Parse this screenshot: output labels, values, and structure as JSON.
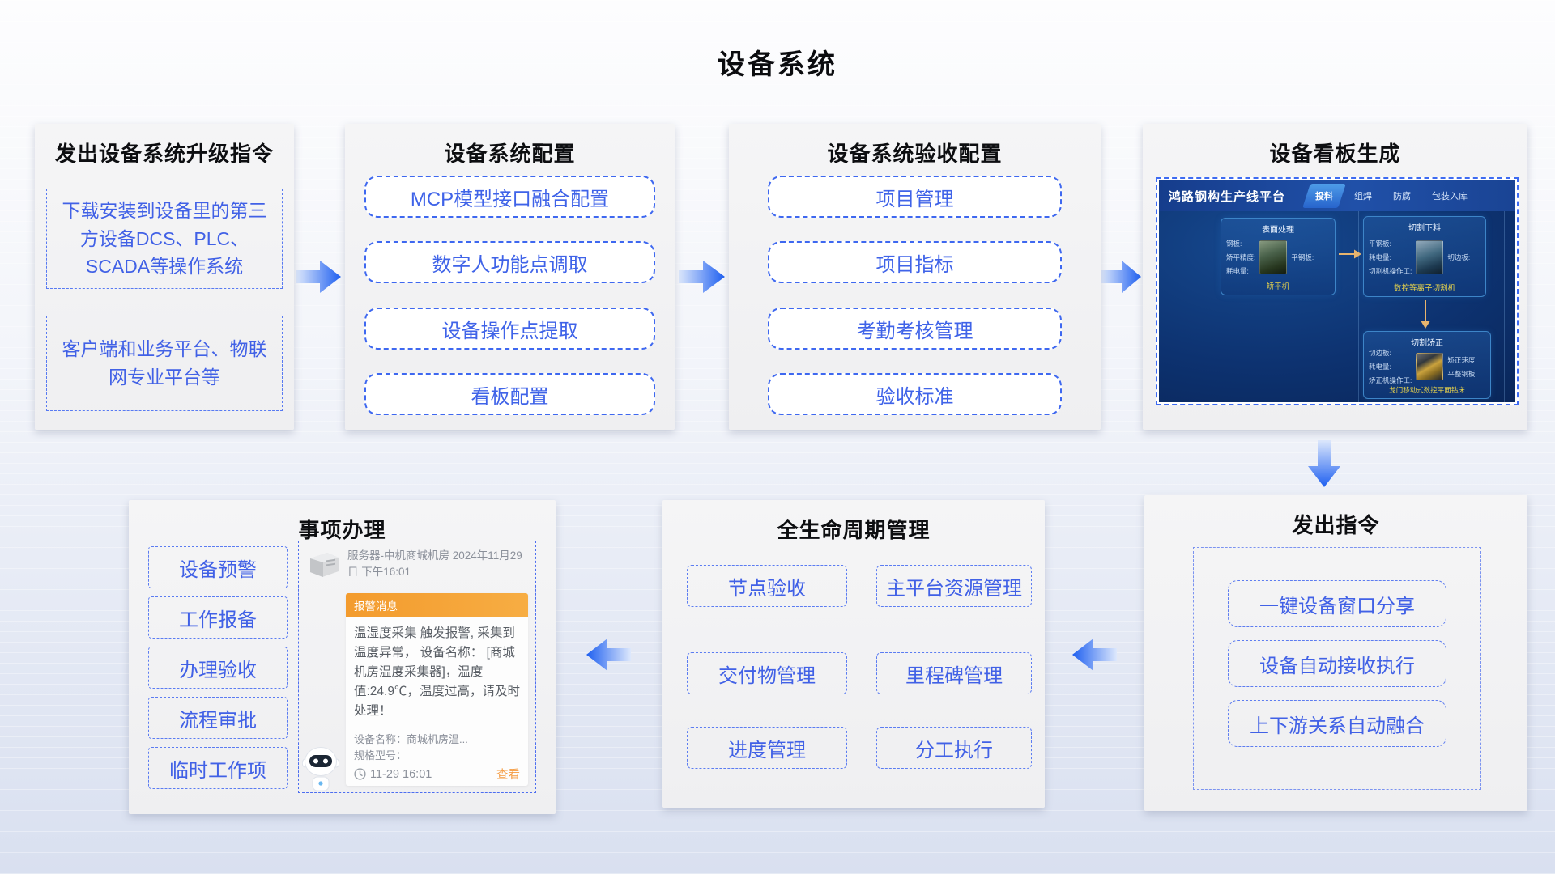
{
  "page": {
    "title": "设备系统"
  },
  "colors": {
    "accent_blue": "#4161e6",
    "flow_arrow_blue": "#1e5ff0",
    "alert_orange": "#f6a13d",
    "dashboard_navy": "#0d3270",
    "machine_label_yellow": "#e9d44c"
  },
  "panels": {
    "upgrade": {
      "title": "发出设备系统升级指令",
      "items": [
        "下载安装到设备里的第三方设备DCS、PLC、SCADA等操作系统",
        "客户端和业务平台、物联网专业平台等"
      ]
    },
    "config": {
      "title": "设备系统配置",
      "items": [
        "MCP模型接口融合配置",
        "数字人功能点调取",
        "设备操作点提取",
        "看板配置"
      ]
    },
    "acceptance": {
      "title": "设备系统验收配置",
      "items": [
        "项目管理",
        "项目指标",
        "考勤考核管理",
        "验收标准"
      ]
    },
    "kanban": {
      "title": "设备看板生成",
      "platform": {
        "name": "鸿路钢构生产线平台",
        "tabs": [
          "投料",
          "组焊",
          "防腐",
          "包装入库"
        ],
        "active_tab": "投料",
        "cards": [
          {
            "title": "表面处理",
            "fields_left": [
              "钢板:",
              "矫平精度:",
              "耗电量:"
            ],
            "fields_right": [
              "平钢板:"
            ],
            "machine": "矫平机"
          },
          {
            "title": "切割下料",
            "fields_left": [
              "平钢板:",
              "耗电量:",
              "切割机操作工:"
            ],
            "fields_right": [
              "切边板:"
            ],
            "machine": "数控等离子切割机"
          },
          {
            "title": "切割矫正",
            "fields_left": [
              "切边板:",
              "耗电量:",
              "矫正机操作工:"
            ],
            "fields_right": [
              "矫正速度:",
              "平整钢板:"
            ],
            "machine": "龙门移动式数控平面钻床"
          }
        ]
      }
    },
    "command": {
      "title": "发出指令",
      "items": [
        "一键设备窗口分享",
        "设备自动接收执行",
        "上下游关系自动融合"
      ]
    },
    "lifecycle": {
      "title": "全生命周期管理",
      "items": [
        "节点验收",
        "主平台资源管理",
        "交付物管理",
        "里程碑管理",
        "进度管理",
        "分工执行"
      ]
    },
    "tasks": {
      "title": "事项办理",
      "items": [
        "设备预警",
        "工作报备",
        "办理验收",
        "流程审批",
        "临时工作项"
      ],
      "notification": {
        "source": "服务器-中机商城机房 2024年11月29日 下午16:01",
        "alert_title": "报警消息",
        "alert_body": "温湿度采集 触发报警, 采集到温度异常， 设备名称： [商城机房温度采集器]，温度值:24.9℃，温度过高，请及时处理！",
        "device_name": "设备名称：商城机房温...",
        "spec": "规格型号：",
        "time": "11-29 16:01",
        "action": "查看"
      }
    }
  }
}
